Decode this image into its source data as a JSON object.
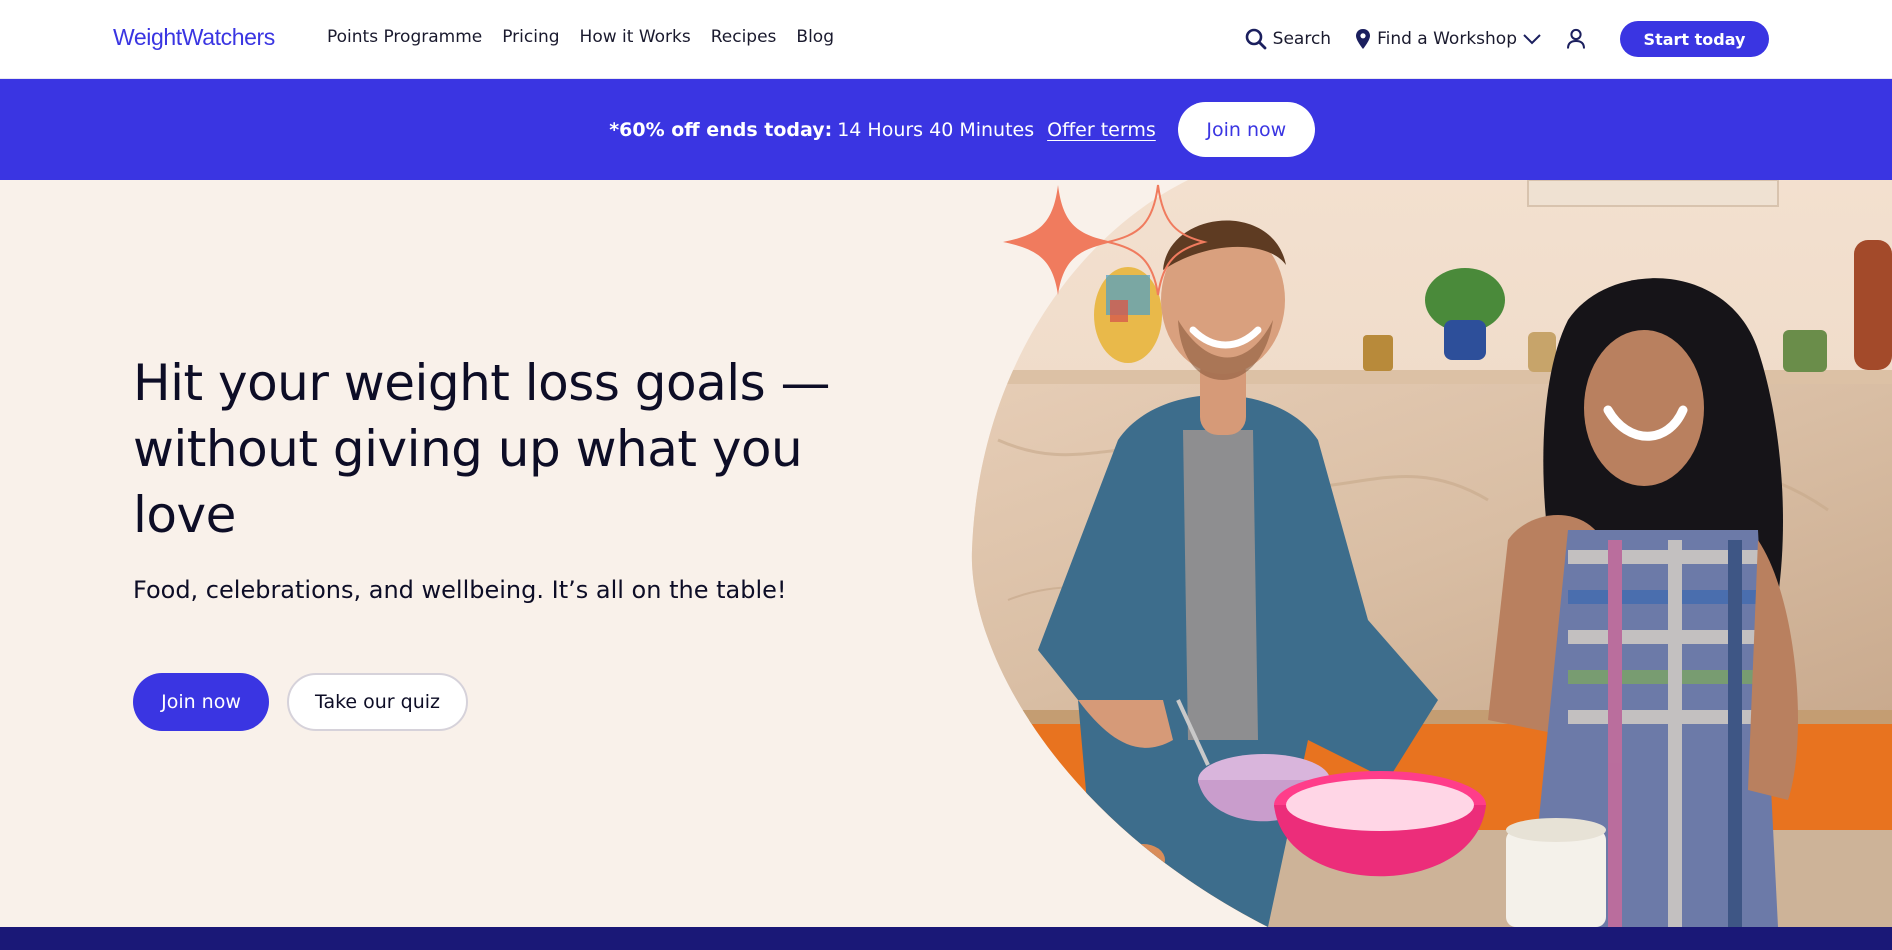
{
  "header": {
    "logo": "WeightWatchers",
    "nav": [
      {
        "label": "Points Programme"
      },
      {
        "label": "Pricing"
      },
      {
        "label": "How it Works"
      },
      {
        "label": "Recipes"
      },
      {
        "label": "Blog"
      }
    ],
    "search_label": "Search",
    "workshop_label": "Find a Workshop",
    "start_label": "Start today"
  },
  "promo": {
    "headline": "*60% off ends today:",
    "countdown": "14 Hours 40 Minutes",
    "terms_label": "Offer terms",
    "join_label": "Join now"
  },
  "hero": {
    "title": "Hit your weight loss goals —without giving up what you love",
    "subtitle": "Food, celebrations, and wellbeing. It’s all on the table!",
    "primary_cta": "Join now",
    "secondary_cta": "Take our quiz"
  },
  "icons": {
    "search": "search-icon",
    "location": "location-pin-icon",
    "chevron": "chevron-down-icon",
    "account": "user-icon"
  },
  "colors": {
    "brand": "#3a35e2",
    "hero_bg": "#f9f1ea",
    "footer_strip": "#1a1877",
    "sparkle": "#f07b5e"
  }
}
